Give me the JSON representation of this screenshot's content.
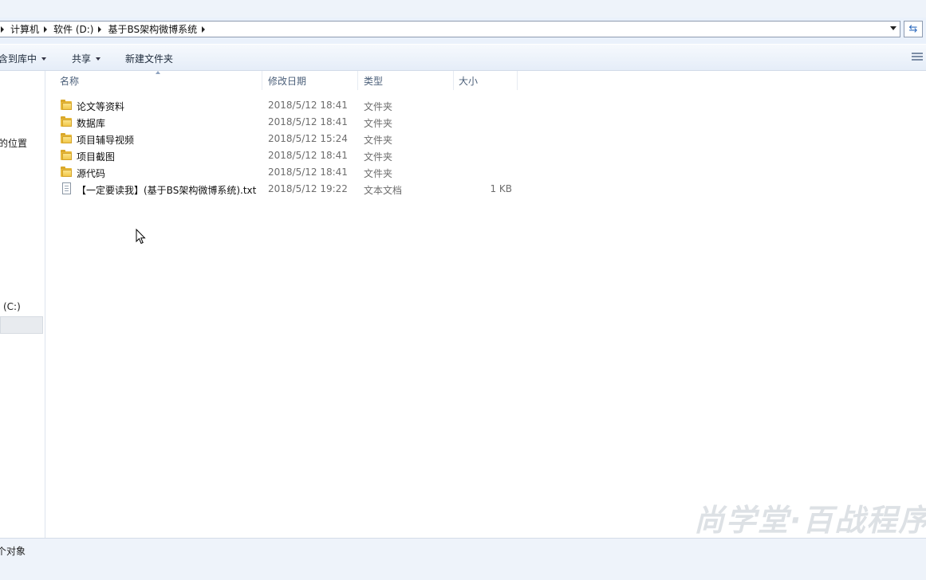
{
  "address_bar": {
    "crumbs": [
      "计算机",
      "软件 (D:)",
      "基于BS架构微博系统"
    ]
  },
  "toolbar": {
    "include_label": "含到库中",
    "share_label": "共享",
    "new_folder_label": "新建文件夹"
  },
  "nav": {
    "locations_label": "的位置",
    "drive_c_label": "(C:)"
  },
  "columns": {
    "name": "名称",
    "date": "修改日期",
    "type": "类型",
    "size": "大小"
  },
  "files": [
    {
      "name": "论文等资料",
      "date": "2018/5/12 18:41",
      "type": "文件夹",
      "size": "",
      "icon": "folder-icon"
    },
    {
      "name": "数据库",
      "date": "2018/5/12 18:41",
      "type": "文件夹",
      "size": "",
      "icon": "folder-icon"
    },
    {
      "name": "项目辅导视频",
      "date": "2018/5/12 15:24",
      "type": "文件夹",
      "size": "",
      "icon": "folder-icon"
    },
    {
      "name": "项目截图",
      "date": "2018/5/12 18:41",
      "type": "文件夹",
      "size": "",
      "icon": "folder-icon"
    },
    {
      "name": "源代码",
      "date": "2018/5/12 18:41",
      "type": "文件夹",
      "size": "",
      "icon": "folder-icon"
    },
    {
      "name": "【一定要读我】(基于BS架构微博系统).txt",
      "date": "2018/5/12 19:22",
      "type": "文本文档",
      "size": "1 KB",
      "icon": "text-document-icon"
    }
  ],
  "status": {
    "item_count_text": "个对象"
  },
  "watermark": {
    "text": "尚学堂·百战程序"
  }
}
